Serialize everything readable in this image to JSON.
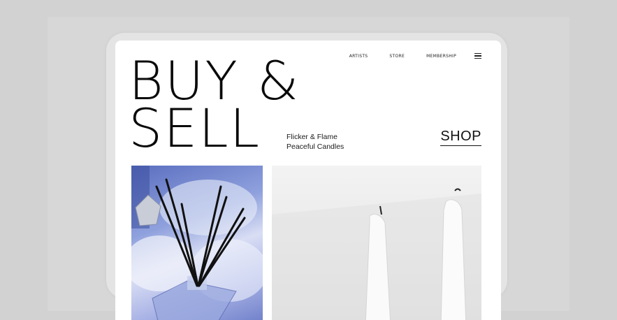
{
  "nav": {
    "links": [
      "ARTISTS",
      "STORE",
      "MEMBERSHIP"
    ],
    "menu_icon": "hamburger-menu-icon"
  },
  "hero": {
    "line1": "BUY &",
    "line2": "SELL"
  },
  "tagline": {
    "line1": "Flicker & Flame",
    "line2": "Peaceful Candles"
  },
  "cta": {
    "shop_label": "SHOP"
  },
  "images": {
    "left": "reed-diffuser-photo",
    "right": "white-candles-photo"
  },
  "colors": {
    "page_bg": "#d2d2d2",
    "device_frame": "#e4e4e4",
    "screen_bg": "#ffffff",
    "text": "#0a0a0a",
    "diffuser_blue": "#7a8ed6"
  }
}
